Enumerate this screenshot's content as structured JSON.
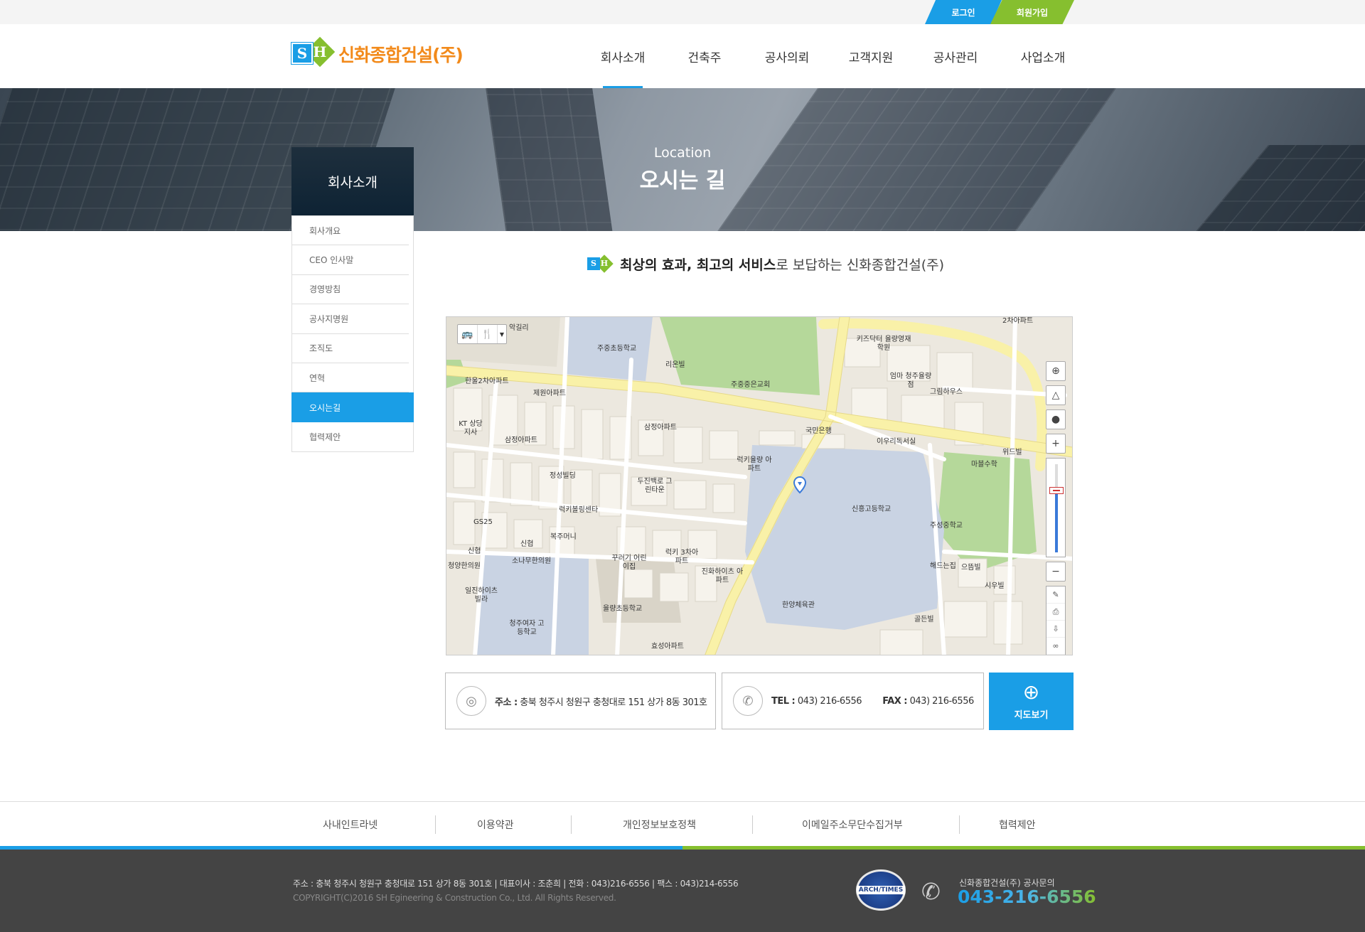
{
  "topbar": {
    "login": "로그인",
    "join": "회원가입"
  },
  "header": {
    "logo_text": "신화종합건설(주)",
    "logo_mark_s": "S",
    "logo_mark_h": "H",
    "nav": [
      "회사소개",
      "건축주",
      "공사의뢰",
      "고객지원",
      "공사관리",
      "사업소개"
    ]
  },
  "banner": {
    "subtitle": "Location",
    "title": "오시는 길"
  },
  "sidebar": {
    "title": "회사소개",
    "items": [
      "회사개요",
      "CEO 인사말",
      "경영방침",
      "공사지명원",
      "조직도",
      "연혁",
      "오시는길",
      "협력제안"
    ]
  },
  "slogan": {
    "strong": "최상의 효과, 최고의 서비스",
    "rest": "로 보답하는 신화종합건설(주)"
  },
  "map": {
    "labels": [
      "악길리",
      "주중초등학교",
      "리온빌",
      "주중중은교회",
      "한울2차아파트",
      "제원아파트",
      "KT 상당지사",
      "삼정아파트",
      "삼정아파트",
      "국민은행",
      "키즈닥터 율량영재학원",
      "엄마 청주율량점",
      "그림하우스",
      "이우리독서실",
      "위드빌",
      "마블수학",
      "럭키율량 아파트",
      "두진백로 그린타운",
      "정성빌딩",
      "럭키볼링센타",
      "GS25",
      "복주머니",
      "신협",
      "신협",
      "소나무한의원",
      "꾸러기 어린이집",
      "럭키 3차아파트",
      "진화하이츠 아파트",
      "신흥고등학교",
      "주성중학교",
      "해드는집",
      "으뜸빌",
      "시우빌",
      "청양한의원",
      "일진하이츠 빌라",
      "율량초등학교",
      "청주여자 고등학교",
      "효성아파트",
      "한양체육관",
      "골든빌",
      "2차아파트"
    ]
  },
  "info": {
    "addr_label": "주소 :",
    "addr_value": "충북 청주시 청원구 충청대로 151 상가 8동 301호",
    "tel_label": "TEL :",
    "tel_value": "043) 216-6556",
    "fax_label": "FAX :",
    "fax_value": "043) 216-6556",
    "mapview": "지도보기"
  },
  "footer_links": [
    "사내인트라넷",
    "이용약관",
    "개인정보보호정책",
    "이메일주소무단수집거부",
    "협력제안"
  ],
  "footer": {
    "address_line": "주소 : 충북 청주시 청원구 충청대로 151 상가 8동 301호  |  대표이사 : 조춘희  |  전화 : 043)216-6556  |  팩스 : 043)214-6556",
    "copyright": "COPYRIGHT(C)2016  SH Egineering & Construction  Co., Ltd. All Rights Reserved.",
    "badge_text": "ARCH/TIMES",
    "cs_label": "신화종합건설(주) 공사문의",
    "cs_number": "043-216-6556"
  },
  "colors": {
    "blue": "#1a9ee6",
    "green": "#86bf2f",
    "orange": "#f28a1b",
    "footer_bg": "#444444"
  }
}
